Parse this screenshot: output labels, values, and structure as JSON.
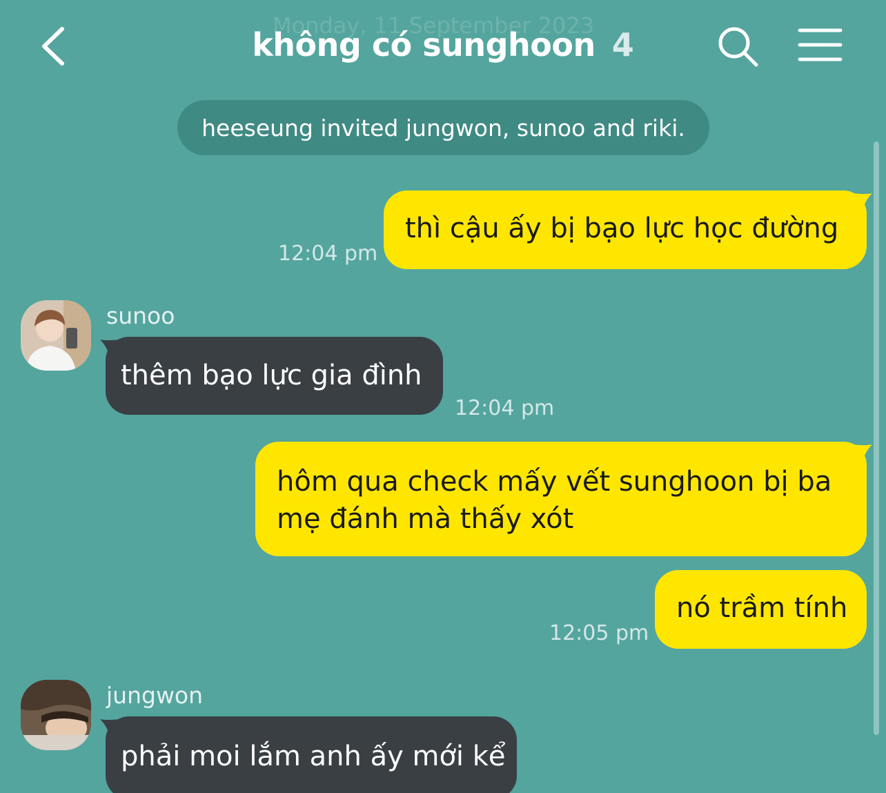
{
  "header": {
    "date_ghost": "Monday, 11 September 2023",
    "title": "không có sunghoon",
    "member_count": "4",
    "icons": {
      "back": "chevron-left-icon",
      "search": "search-icon",
      "menu": "hamburger-menu-icon"
    }
  },
  "notice": "heeseung invited jungwon, sunoo and riki.",
  "colors": {
    "background": "#54a59e",
    "my_bubble": "#fee600",
    "their_bubble": "#3a3f44"
  },
  "messages": [
    {
      "from": "me",
      "text": "thì cậu ấy bị bạo lực học đường",
      "time": "12:04 pm"
    },
    {
      "from": "sunoo",
      "sender": "sunoo",
      "text": "thêm bạo lực gia đình",
      "time": "12:04 pm"
    },
    {
      "from": "me",
      "lines": [
        "hôm qua check mấy vết sunghoon bị ba",
        "mẹ đánh mà thấy xót"
      ]
    },
    {
      "from": "me",
      "text": "nó trầm tính",
      "time": "12:05 pm"
    },
    {
      "from": "jungwon",
      "sender": "jungwon",
      "text": "phải moi lắm anh ấy mới kể"
    }
  ]
}
